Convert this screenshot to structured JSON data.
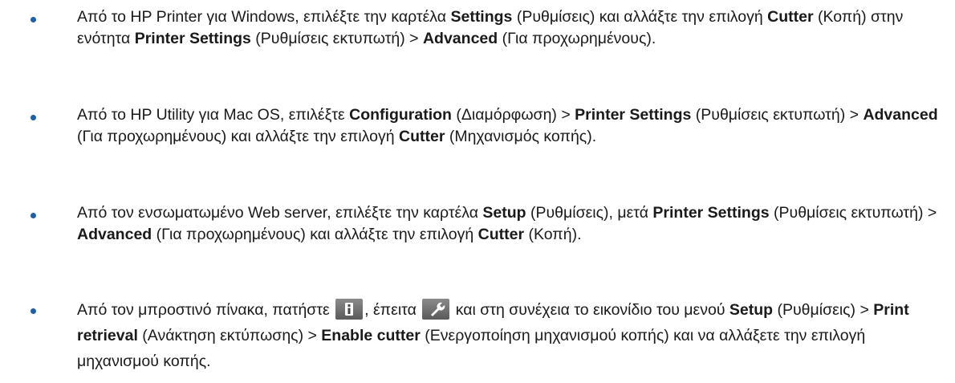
{
  "items": [
    {
      "parts": [
        {
          "t": "Από το HP Printer για Windows, επιλέξτε την καρτέλα "
        },
        {
          "t": "Settings",
          "b": true
        },
        {
          "t": " (Ρυθμίσεις) και αλλάξτε την επιλογή "
        },
        {
          "t": "Cutter",
          "b": true
        },
        {
          "t": " (Κοπή) στην ενότητα "
        },
        {
          "t": "Printer Settings",
          "b": true
        },
        {
          "t": " (Ρυθμίσεις εκτυπωτή) > "
        },
        {
          "t": "Advanced",
          "b": true
        },
        {
          "t": " (Για προχωρημένους)."
        }
      ]
    },
    {
      "parts": [
        {
          "t": "Από το HP Utility για Mac OS, επιλέξτε "
        },
        {
          "t": "Configuration",
          "b": true
        },
        {
          "t": " (Διαμόρφωση) > "
        },
        {
          "t": "Printer Settings",
          "b": true
        },
        {
          "t": " (Ρυθμίσεις εκτυπωτή) > "
        },
        {
          "t": "Advanced",
          "b": true
        },
        {
          "t": " (Για προχωρημένους) και αλλάξτε την επιλογή "
        },
        {
          "t": "Cutter",
          "b": true
        },
        {
          "t": " (Μηχανισμός κοπής)."
        }
      ]
    },
    {
      "parts": [
        {
          "t": "Από τον ενσωματωμένο Web server, επιλέξτε την καρτέλα "
        },
        {
          "t": "Setup",
          "b": true
        },
        {
          "t": " (Ρυθμίσεις), μετά "
        },
        {
          "t": "Printer Settings",
          "b": true
        },
        {
          "t": " (Ρυθμίσεις εκτυπωτή) > "
        },
        {
          "t": "Advanced",
          "b": true
        },
        {
          "t": " (Για προχωρημένους) και αλλάξτε την επιλογή "
        },
        {
          "t": "Cutter",
          "b": true
        },
        {
          "t": " (Κοπή)."
        }
      ]
    },
    {
      "parts": [
        {
          "t": "Από τον μπροστινό πίνακα, πατήστε "
        },
        {
          "icon": "info-icon"
        },
        {
          "t": ", έπειτα "
        },
        {
          "icon": "wrench-icon"
        },
        {
          "t": " και στη συνέχεια το εικονίδιο του μενού "
        },
        {
          "t": "Setup",
          "b": true
        },
        {
          "t": " (Ρυθμίσεις) > "
        },
        {
          "t": "Print retrieval",
          "b": true
        },
        {
          "t": " (Ανάκτηση εκτύπωσης) > "
        },
        {
          "t": "Enable cutter",
          "b": true
        },
        {
          "t": " (Ενεργοποίηση μηχανισμού κοπής) και να αλλάξετε την επιλογή μηχανισμού κοπής."
        }
      ]
    }
  ],
  "colors": {
    "bullet": "#1f5fa8",
    "text": "#1a1a1a",
    "icon_bg": "#5a5a5a"
  }
}
